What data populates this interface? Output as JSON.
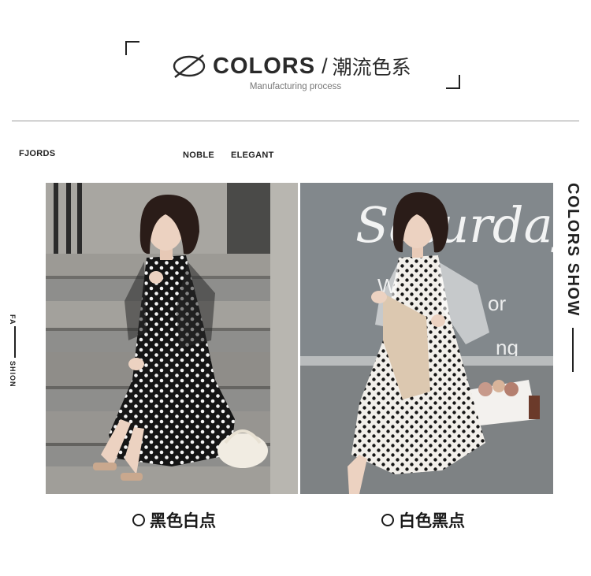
{
  "header": {
    "title_en": "COLORS",
    "slash": "/",
    "title_cn": "潮流色系",
    "subtitle": "Manufacturing process"
  },
  "labels": {
    "brand": "FJORDS",
    "noble": "NOBLE",
    "elegant": "ELEGANT",
    "side_left_top": "FA",
    "side_left_bottom": "SHION",
    "side_right": "COLORS SHOW"
  },
  "products": [
    {
      "caption": "黑色白点",
      "dress": "black with white polka dots",
      "dress_color": "#141414",
      "dot_color": "#ffffff"
    },
    {
      "caption": "白色黑点",
      "dress": "white with black polka dots",
      "dress_color": "#f2efea",
      "dot_color": "#151515"
    }
  ],
  "photo_signs": {
    "storefront_script": "Saturdays",
    "storefront_line_2": "We",
    "storefront_line_3": "or",
    "storefront_line_4": "ng"
  },
  "colors": {
    "text": "#1f1f1f",
    "divider": "#9a9a9a",
    "subtitle": "#777777"
  }
}
